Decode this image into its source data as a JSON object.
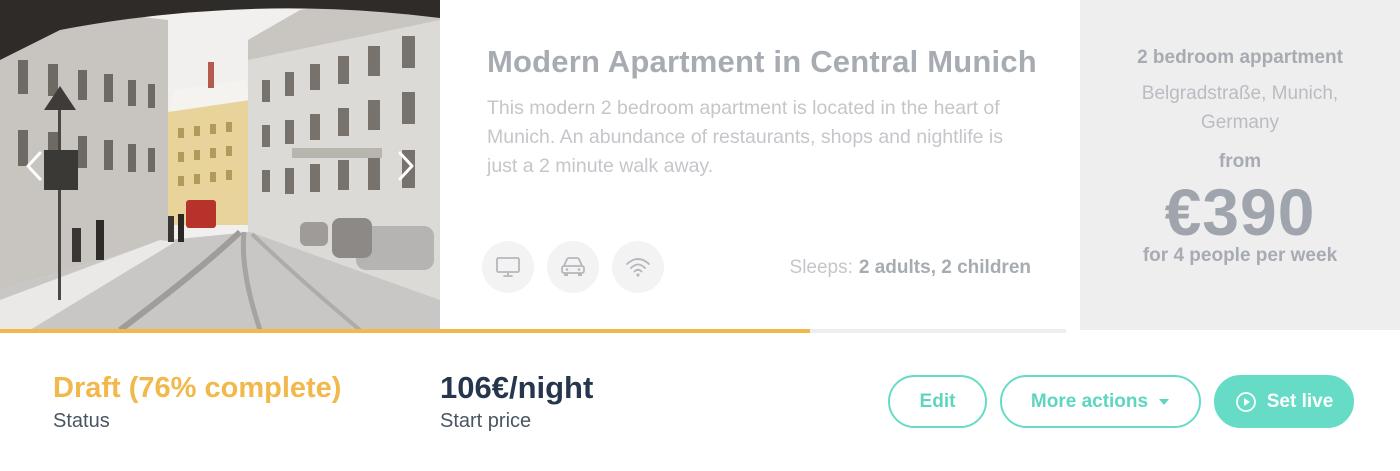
{
  "listing": {
    "title": "Modern Apartment in Central Munich",
    "description": "This modern 2 bedroom  apartment is located in the heart of Munich. An abundance of restaurants, shops and nightlife is just a 2 minute walk away.",
    "sleeps_label": "Sleeps:",
    "sleeps_value": "2 adults, 2 children",
    "amenities": [
      "tv-icon",
      "car-icon",
      "wifi-icon"
    ],
    "completion_fraction": 0.76
  },
  "summary": {
    "type": "2 bedroom appartment",
    "address": "Belgradstraße, Munich, Germany",
    "from_label": "from",
    "price": "€390",
    "per_label": "for 4 people per week"
  },
  "status": {
    "value": "Draft (76% complete)",
    "label": "Status"
  },
  "start_price": {
    "value": "106€/night",
    "label": "Start price"
  },
  "actions": {
    "edit": "Edit",
    "more": "More actions",
    "set_live": "Set live"
  },
  "colors": {
    "accent_teal": "#66dcc6",
    "draft_orange": "#f2b84b",
    "heading_navy": "#26374d"
  }
}
